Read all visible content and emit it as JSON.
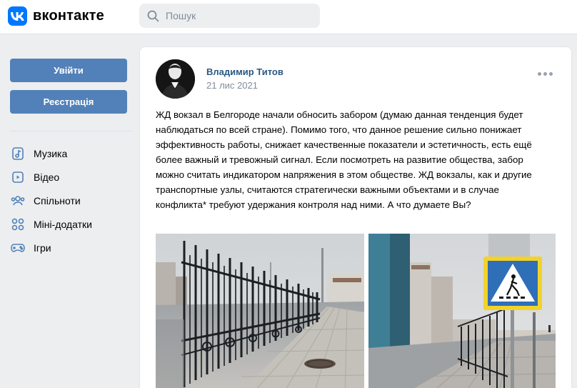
{
  "header": {
    "logo_text": "вконтакте",
    "search_placeholder": "Пошук"
  },
  "sidebar": {
    "login_label": "Увійти",
    "register_label": "Реєстрація",
    "items": [
      {
        "label": "Музика",
        "icon": "music-icon"
      },
      {
        "label": "Відео",
        "icon": "video-icon"
      },
      {
        "label": "Спільноти",
        "icon": "communities-icon"
      },
      {
        "label": "Міні-додатки",
        "icon": "apps-icon"
      },
      {
        "label": "Ігри",
        "icon": "games-icon"
      }
    ]
  },
  "post": {
    "author": "Владимир Титов",
    "date": "21 лис 2021",
    "text": "ЖД вокзал в Белгороде начали обносить забором (думаю данная тенденция будет наблюдаться по всей стране). Помимо того, что данное решение сильно понижает эффективность работы, снижает качественные показатели и эстетичность, есть ещё более важный и тревожный сигнал. Если посмотреть на развитие общества, забор можно считать индикатором напряжения в этом обществе. ЖД вокзалы, как и другие транспортные узлы, считаются стратегически важными объектами и в случае конфликта* требуют удержания контроля над ними. А что думаете Вы?"
  },
  "colors": {
    "brand": "#0077ff",
    "button": "#5181b8",
    "link": "#2a5885",
    "muted": "#818c99",
    "background": "#edeef0"
  }
}
